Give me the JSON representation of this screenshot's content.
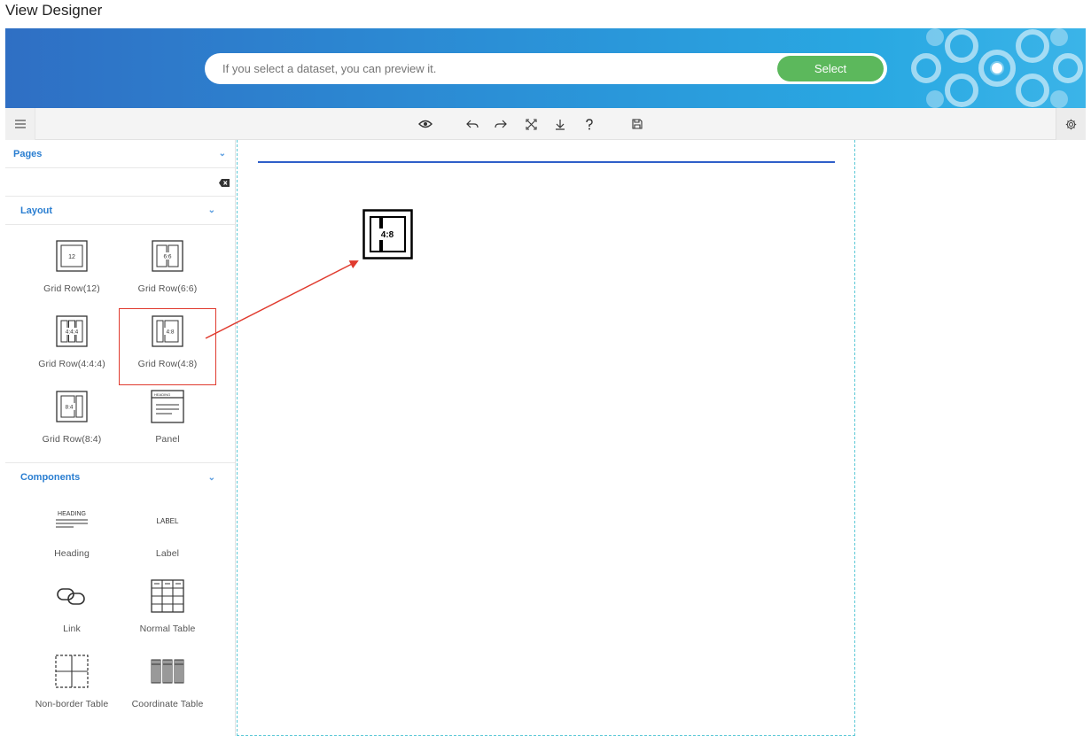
{
  "app": {
    "title": "View Designer"
  },
  "banner": {
    "search_placeholder": "If you select a dataset, you can preview it.",
    "select_label": "Select",
    "select_color": "#5cb85c"
  },
  "toolbar": {
    "icons": [
      "menu-icon",
      "preview-eye-icon",
      "undo-icon",
      "redo-icon",
      "fullscreen-icon",
      "download-icon",
      "help-icon",
      "save-icon",
      "settings-gear-icon"
    ]
  },
  "sidebar": {
    "pages": {
      "title": "Pages"
    },
    "layout": {
      "title": "Layout",
      "items": [
        {
          "label": "Grid Row(12)",
          "glyph": "12"
        },
        {
          "label": "Grid Row(6:6)",
          "glyph": "6:6"
        },
        {
          "label": "Grid Row(4:4:4)",
          "glyph": "4:4:4"
        },
        {
          "label": "Grid Row(4:8)",
          "glyph": "4:8"
        },
        {
          "label": "Grid Row(8:4)",
          "glyph": "8:4"
        },
        {
          "label": "Panel",
          "glyph": "HEADING"
        }
      ]
    },
    "components": {
      "title": "Components",
      "items": [
        {
          "label": "Heading",
          "glyph": "HEADING"
        },
        {
          "label": "Label",
          "glyph": "LABEL"
        },
        {
          "label": "Link"
        },
        {
          "label": "Normal Table"
        },
        {
          "label": "Non-border Table"
        },
        {
          "label": "Coordinate Table"
        }
      ]
    }
  },
  "canvas": {
    "drag_glyph": "4:8",
    "accent": "#2f5fc9",
    "annotation_color": "#e03a2e"
  }
}
